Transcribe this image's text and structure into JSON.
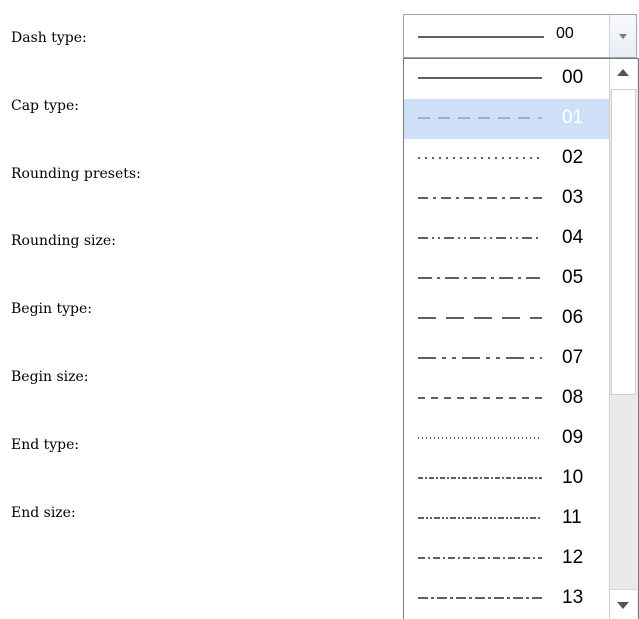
{
  "labels": [
    "Dash type:",
    "Cap type:",
    "Rounding presets:",
    "Rounding size:",
    "Begin type:",
    "Begin size:",
    "End type:",
    "End size:"
  ],
  "combo": {
    "value": "00",
    "pattern": "solid"
  },
  "dropdown": {
    "selected_code": "01",
    "items": [
      {
        "code": "00",
        "pattern": "solid"
      },
      {
        "code": "01",
        "pattern": "dash"
      },
      {
        "code": "02",
        "pattern": "dot"
      },
      {
        "code": "03",
        "pattern": "dash-dot"
      },
      {
        "code": "04",
        "pattern": "dash-dot-dot"
      },
      {
        "code": "05",
        "pattern": "long-dash-dot"
      },
      {
        "code": "06",
        "pattern": "long-dash"
      },
      {
        "code": "07",
        "pattern": "long-dash-dot-dot"
      },
      {
        "code": "08",
        "pattern": "short-dash"
      },
      {
        "code": "09",
        "pattern": "fine-dot"
      },
      {
        "code": "10",
        "pattern": "small-dash-dot"
      },
      {
        "code": "11",
        "pattern": "small-dash-dot-dot"
      },
      {
        "code": "12",
        "pattern": "small-dash-dot-alt"
      },
      {
        "code": "13",
        "pattern": "medium-dash-dot"
      }
    ]
  },
  "colors": {
    "selection": "#cde0f7",
    "border": "#7a7a7a",
    "line": "#000000"
  }
}
